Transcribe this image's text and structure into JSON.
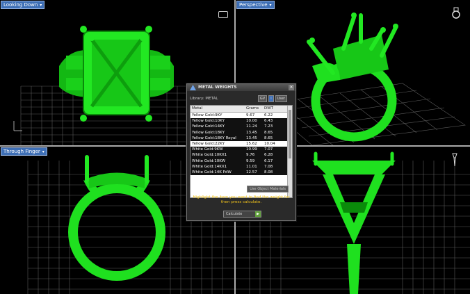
{
  "viewports": {
    "top_left": {
      "label": "Looking Down"
    },
    "top_right": {
      "label": "Perspective"
    },
    "bottom_left": {
      "label": "Through Finger"
    },
    "bottom_right": {
      "label": ""
    }
  },
  "dialog": {
    "title": "METAL WEIGHTS",
    "library_label": "Library: METAL",
    "btn_gv": "GV",
    "btn_user": "User",
    "columns": [
      "Metal",
      "Grams",
      "DWT"
    ],
    "rows": [
      [
        "Yellow Gold:9KY",
        "9.67",
        "6.22"
      ],
      [
        "Yellow Gold:10KY",
        "10.00",
        "6.43"
      ],
      [
        "Yellow Gold:14KY",
        "11.24",
        "7.23"
      ],
      [
        "Yellow Gold:18KY",
        "13.45",
        "8.65"
      ],
      [
        "Yellow Gold:18KY Royal",
        "13.45",
        "8.65"
      ],
      [
        "Yellow Gold:22KY",
        "15.62",
        "10.04"
      ],
      [
        "White Gold:9KW",
        "10.99",
        "7.07"
      ],
      [
        "White Gold:10KX1",
        "9.76",
        "6.28"
      ],
      [
        "White Gold:10KW",
        "9.59",
        "6.17"
      ],
      [
        "White Gold:14KX1",
        "11.01",
        "7.08"
      ],
      [
        "White Gold:14K PdW",
        "12.57",
        "8.08"
      ]
    ],
    "use_object_materials": "Use Object Materials",
    "hint": "Highlight the item you want to find the weight for then press calculate.",
    "calculate": "Calculate"
  },
  "colors": {
    "ring": "#1fe01f",
    "ring_dark": "#0a8a0a",
    "grid": "#6a6a6a",
    "label_bg": "#3e6fb6",
    "hint": "#f0c21b"
  }
}
